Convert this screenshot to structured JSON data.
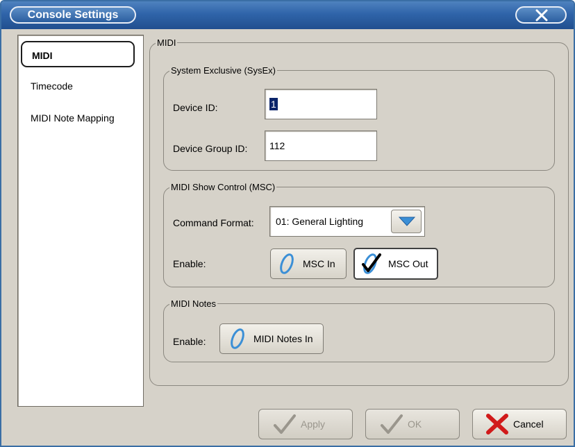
{
  "window": {
    "title": "Console Settings"
  },
  "nav": {
    "items": [
      {
        "label": "MIDI",
        "selected": true
      },
      {
        "label": "Timecode",
        "selected": false
      },
      {
        "label": "MIDI Note Mapping",
        "selected": false
      }
    ]
  },
  "midi": {
    "title": "MIDI",
    "sysex": {
      "title": "System Exclusive (SysEx)",
      "device_id_label": "Device ID:",
      "device_id_value": "1",
      "device_group_id_label": "Device Group ID:",
      "device_group_id_value": "112"
    },
    "msc": {
      "title": "MIDI Show Control (MSC)",
      "command_format_label": "Command Format:",
      "command_format_value": "01: General Lighting",
      "enable_label": "Enable:",
      "msc_in_label": "MSC In",
      "msc_in_checked": false,
      "msc_out_label": "MSC Out",
      "msc_out_checked": true
    },
    "notes": {
      "title": "MIDI Notes",
      "enable_label": "Enable:",
      "notes_in_label": "MIDI Notes In",
      "notes_in_checked": false
    }
  },
  "actions": {
    "apply_label": "Apply",
    "ok_label": "OK",
    "cancel_label": "Cancel",
    "apply_enabled": false,
    "ok_enabled": false
  },
  "colors": {
    "titlebar": "#2f64a9",
    "body": "#d6d2c9",
    "cancel_x": "#d11a1a",
    "unchecked_ring": "#3b8fd6",
    "disabled_check": "#9a968d"
  }
}
